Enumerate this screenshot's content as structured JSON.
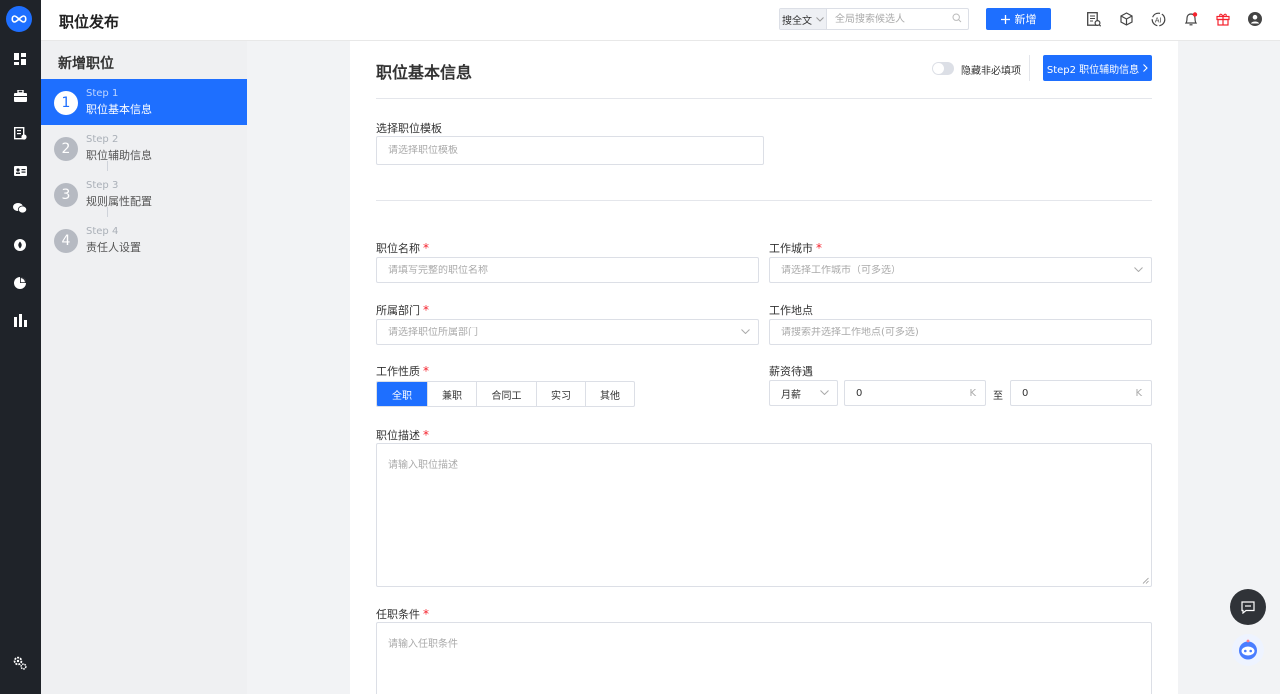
{
  "app": {
    "logo_text": "∞",
    "page_title": "职位发布",
    "brand_color": "#1e6fff"
  },
  "rail": {
    "icons": [
      "dashboard-icon",
      "briefcase-icon",
      "resume-icon",
      "id-card-icon",
      "wechat-icon",
      "fire-icon",
      "pie-chart-icon",
      "bar-chart-icon",
      "settings-icon"
    ]
  },
  "header": {
    "search_scope": "搜全文",
    "search_placeholder": "全局搜索候选人",
    "add_label": "新增",
    "icons": [
      "report-icon",
      "cube-icon",
      "ai-icon",
      "bell-icon",
      "gift-icon",
      "user-icon"
    ]
  },
  "steps": {
    "title": "新增职位",
    "items": [
      {
        "num": "1",
        "sub": "Step 1",
        "label": "职位基本信息",
        "active": true
      },
      {
        "num": "2",
        "sub": "Step 2",
        "label": "职位辅助信息",
        "active": false
      },
      {
        "num": "3",
        "sub": "Step 3",
        "label": "规则属性配置",
        "active": false
      },
      {
        "num": "4",
        "sub": "Step 4",
        "label": "责任人设置",
        "active": false
      }
    ]
  },
  "form": {
    "section_title": "职位基本信息",
    "toggle_label": "隐藏非必填项",
    "next_label": "Step2 职位辅助信息",
    "template": {
      "label": "选择职位模板",
      "placeholder": "请选择职位模板"
    },
    "job_name": {
      "label": "职位名称",
      "placeholder": "请填写完整的职位名称"
    },
    "city": {
      "label": "工作城市",
      "placeholder": "请选择工作城市（可多选）"
    },
    "dept": {
      "label": "所属部门",
      "placeholder": "请选择职位所属部门"
    },
    "location": {
      "label": "工作地点",
      "placeholder": "请搜索并选择工作地点(可多选)"
    },
    "nature": {
      "label": "工作性质",
      "options": [
        "全职",
        "兼职",
        "合同工",
        "实习",
        "其他"
      ],
      "selected": "全职"
    },
    "salary": {
      "label": "薪资待遇",
      "period": "月薪",
      "min": "0",
      "max": "0",
      "unit": "K",
      "to": "至"
    },
    "desc": {
      "label": "职位描述",
      "placeholder": "请输入职位描述"
    },
    "req": {
      "label": "任职条件",
      "placeholder": "请输入任职条件"
    }
  }
}
